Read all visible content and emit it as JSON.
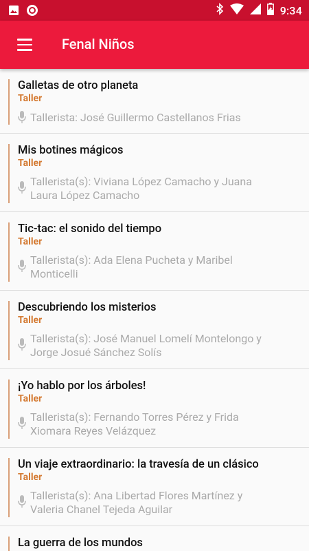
{
  "status_bar": {
    "time": "9:34",
    "icons": [
      "image-icon",
      "record-icon",
      "bluetooth-icon",
      "wifi-icon",
      "signal-icon",
      "battery-charging-icon"
    ]
  },
  "app_bar": {
    "title": "Fenal Niños",
    "menu_icon": "hamburger-menu-icon"
  },
  "colors": {
    "status_bar": "#c8102e",
    "app_bar": "#ec1a3c",
    "type_label": "#d47a32",
    "accent_bar": "#d9a07a",
    "secondary_text": "#aaaaaa"
  },
  "workshops": [
    {
      "title": "Galletas de otro planeta",
      "type": "Taller",
      "people_lines": [
        "Tallerista: José Guillermo Castellanos Frias"
      ]
    },
    {
      "title": "Mis botines mágicos",
      "type": "Taller",
      "people_lines": [
        "Tallerista(s): Viviana López Camacho y Juana",
        "Laura López Camacho"
      ]
    },
    {
      "title": "Tic-tac: el sonido del tiempo",
      "type": "Taller",
      "people_lines": [
        "Tallerista(s): Ada Elena Pucheta y Maribel",
        "Monticelli"
      ]
    },
    {
      "title": "Descubriendo los misterios",
      "type": "Taller",
      "people_lines": [
        "Tallerista(s): José Manuel Lomelí Montelongo y",
        "Jorge Josué Sánchez Solís"
      ]
    },
    {
      "title": "¡Yo hablo por los árboles!",
      "type": "Taller",
      "people_lines": [
        "Tallerista(s): Fernando Torres Pérez y Frida",
        "Xiomara Reyes Velázquez"
      ]
    },
    {
      "title": "Un viaje extraordinario: la travesía de un clásico",
      "type": "Taller",
      "people_lines": [
        "Tallerista(s): Ana Libertad Flores Martínez y",
        "Valeria Chanel Tejeda Aguilar"
      ]
    },
    {
      "title": "La guerra de los mundos",
      "type": "",
      "people_lines": []
    }
  ]
}
